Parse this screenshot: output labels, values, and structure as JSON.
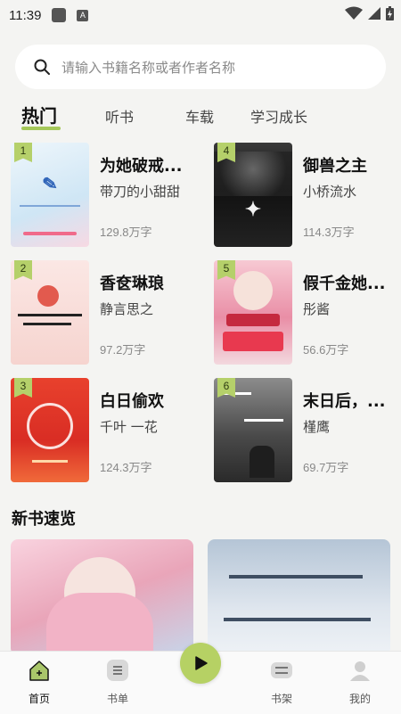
{
  "status_bar": {
    "time": "11:39",
    "a_glyph": "A"
  },
  "search": {
    "placeholder": "请输入书籍名称或者作者名称"
  },
  "tabs": [
    {
      "label": "热门",
      "active": true
    },
    {
      "label": "听书",
      "active": false
    },
    {
      "label": "车载",
      "active": false
    },
    {
      "label": "学习成长",
      "active": false
    }
  ],
  "books": [
    {
      "rank": "1",
      "title": "为她破戒...",
      "author": "带刀的小甜甜",
      "words": "129.8万字"
    },
    {
      "rank": "4",
      "title": "御兽之主",
      "author": "小桥流水",
      "words": "114.3万字"
    },
    {
      "rank": "2",
      "title": "香奁琳琅",
      "author": "静言思之",
      "words": "97.2万字"
    },
    {
      "rank": "5",
      "title": "假千金她...",
      "author": "彤酱",
      "words": "56.6万字"
    },
    {
      "rank": "3",
      "title": "白日偷欢",
      "author": "千叶 一花",
      "words": "124.3万字"
    },
    {
      "rank": "6",
      "title": "末日后，...",
      "author": "槿鹰",
      "words": "69.7万字"
    }
  ],
  "new_books": {
    "title": "新书速览"
  },
  "bottom_nav": [
    {
      "label": "首页",
      "icon": "home-icon",
      "active": true
    },
    {
      "label": "书单",
      "icon": "list-icon",
      "active": false
    },
    {
      "label": "",
      "icon": "play-icon",
      "active": false
    },
    {
      "label": "书架",
      "icon": "bookshelf-icon",
      "active": false
    },
    {
      "label": "我的",
      "icon": "profile-icon",
      "active": false
    }
  ],
  "colors": {
    "accent": "#b6d164",
    "background": "#f4f4f2"
  }
}
